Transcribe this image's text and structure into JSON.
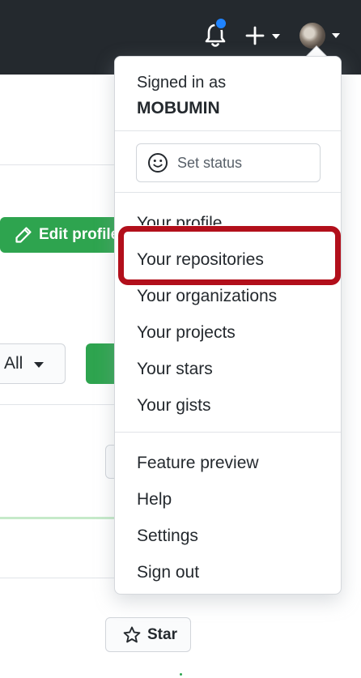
{
  "header": {
    "notification_icon": "bell-icon",
    "notification_dot_color": "#1f83ff",
    "create_icon": "plus-icon",
    "avatar_icon": "user-avatar"
  },
  "background": {
    "edit_profile_label": "Edit profile",
    "filter_select_value": "All",
    "star_label": "Star"
  },
  "dropdown": {
    "signed_in_label": "Signed in as",
    "username": "MOBUMIN",
    "status_placeholder": "Set status",
    "items": [
      "Your profile",
      "Your repositories",
      "Your organizations",
      "Your projects",
      "Your stars",
      "Your gists",
      "Feature preview",
      "Help",
      "Settings",
      "Sign out"
    ]
  },
  "colors": {
    "header_bg": "#24292e",
    "primary_green": "#2ea44f",
    "highlight_red": "#b20f1b"
  }
}
